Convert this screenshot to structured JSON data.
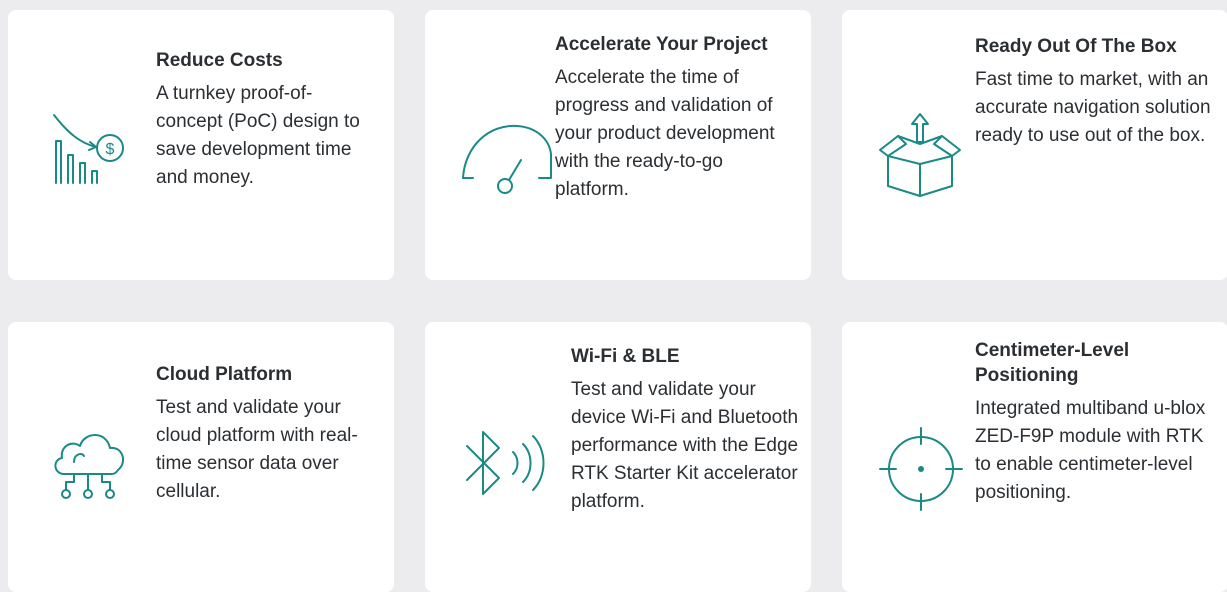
{
  "cards": [
    {
      "icon": "cost-chart-dollar-icon",
      "title": "Reduce Costs",
      "description": "A turnkey proof-of-concept (PoC) design to save development time and money."
    },
    {
      "icon": "speedometer-icon",
      "title": "Accelerate Your Project",
      "description": "Accelerate the time of progress and validation of your product development with the ready-to-go platform."
    },
    {
      "icon": "open-box-arrow-icon",
      "title": "Ready Out Of The Box",
      "description": "Fast time to market, with an accurate navigation solution ready to use out of the box."
    },
    {
      "icon": "cloud-network-icon",
      "title": "Cloud Platform",
      "description": "Test and validate your cloud platform with real-time sensor data over cellular."
    },
    {
      "icon": "bluetooth-signal-icon",
      "title": "Wi-Fi & BLE",
      "description": "Test and validate your device Wi-Fi and Bluetooth performance with the Edge RTK Starter Kit accelerator platform."
    },
    {
      "icon": "crosshair-target-icon",
      "title": "Centimeter-Level Positioning",
      "description": "Integrated multiband u-blox ZED-F9P module with RTK to enable centimeter-level positioning."
    }
  ]
}
